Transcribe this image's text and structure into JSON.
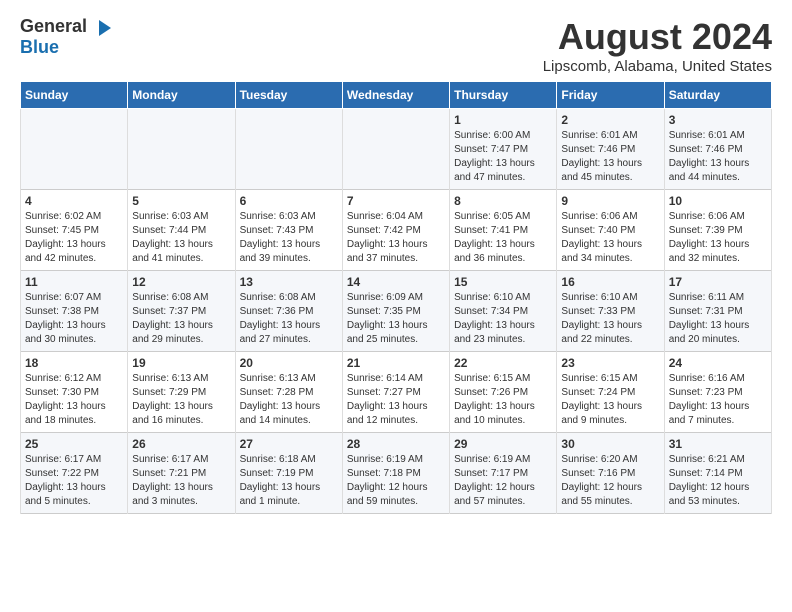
{
  "logo": {
    "general": "General",
    "blue": "Blue"
  },
  "title": {
    "month": "August 2024",
    "location": "Lipscomb, Alabama, United States"
  },
  "headers": [
    "Sunday",
    "Monday",
    "Tuesday",
    "Wednesday",
    "Thursday",
    "Friday",
    "Saturday"
  ],
  "weeks": [
    [
      {
        "day": "",
        "info": ""
      },
      {
        "day": "",
        "info": ""
      },
      {
        "day": "",
        "info": ""
      },
      {
        "day": "",
        "info": ""
      },
      {
        "day": "1",
        "info": "Sunrise: 6:00 AM\nSunset: 7:47 PM\nDaylight: 13 hours\nand 47 minutes."
      },
      {
        "day": "2",
        "info": "Sunrise: 6:01 AM\nSunset: 7:46 PM\nDaylight: 13 hours\nand 45 minutes."
      },
      {
        "day": "3",
        "info": "Sunrise: 6:01 AM\nSunset: 7:46 PM\nDaylight: 13 hours\nand 44 minutes."
      }
    ],
    [
      {
        "day": "4",
        "info": "Sunrise: 6:02 AM\nSunset: 7:45 PM\nDaylight: 13 hours\nand 42 minutes."
      },
      {
        "day": "5",
        "info": "Sunrise: 6:03 AM\nSunset: 7:44 PM\nDaylight: 13 hours\nand 41 minutes."
      },
      {
        "day": "6",
        "info": "Sunrise: 6:03 AM\nSunset: 7:43 PM\nDaylight: 13 hours\nand 39 minutes."
      },
      {
        "day": "7",
        "info": "Sunrise: 6:04 AM\nSunset: 7:42 PM\nDaylight: 13 hours\nand 37 minutes."
      },
      {
        "day": "8",
        "info": "Sunrise: 6:05 AM\nSunset: 7:41 PM\nDaylight: 13 hours\nand 36 minutes."
      },
      {
        "day": "9",
        "info": "Sunrise: 6:06 AM\nSunset: 7:40 PM\nDaylight: 13 hours\nand 34 minutes."
      },
      {
        "day": "10",
        "info": "Sunrise: 6:06 AM\nSunset: 7:39 PM\nDaylight: 13 hours\nand 32 minutes."
      }
    ],
    [
      {
        "day": "11",
        "info": "Sunrise: 6:07 AM\nSunset: 7:38 PM\nDaylight: 13 hours\nand 30 minutes."
      },
      {
        "day": "12",
        "info": "Sunrise: 6:08 AM\nSunset: 7:37 PM\nDaylight: 13 hours\nand 29 minutes."
      },
      {
        "day": "13",
        "info": "Sunrise: 6:08 AM\nSunset: 7:36 PM\nDaylight: 13 hours\nand 27 minutes."
      },
      {
        "day": "14",
        "info": "Sunrise: 6:09 AM\nSunset: 7:35 PM\nDaylight: 13 hours\nand 25 minutes."
      },
      {
        "day": "15",
        "info": "Sunrise: 6:10 AM\nSunset: 7:34 PM\nDaylight: 13 hours\nand 23 minutes."
      },
      {
        "day": "16",
        "info": "Sunrise: 6:10 AM\nSunset: 7:33 PM\nDaylight: 13 hours\nand 22 minutes."
      },
      {
        "day": "17",
        "info": "Sunrise: 6:11 AM\nSunset: 7:31 PM\nDaylight: 13 hours\nand 20 minutes."
      }
    ],
    [
      {
        "day": "18",
        "info": "Sunrise: 6:12 AM\nSunset: 7:30 PM\nDaylight: 13 hours\nand 18 minutes."
      },
      {
        "day": "19",
        "info": "Sunrise: 6:13 AM\nSunset: 7:29 PM\nDaylight: 13 hours\nand 16 minutes."
      },
      {
        "day": "20",
        "info": "Sunrise: 6:13 AM\nSunset: 7:28 PM\nDaylight: 13 hours\nand 14 minutes."
      },
      {
        "day": "21",
        "info": "Sunrise: 6:14 AM\nSunset: 7:27 PM\nDaylight: 13 hours\nand 12 minutes."
      },
      {
        "day": "22",
        "info": "Sunrise: 6:15 AM\nSunset: 7:26 PM\nDaylight: 13 hours\nand 10 minutes."
      },
      {
        "day": "23",
        "info": "Sunrise: 6:15 AM\nSunset: 7:24 PM\nDaylight: 13 hours\nand 9 minutes."
      },
      {
        "day": "24",
        "info": "Sunrise: 6:16 AM\nSunset: 7:23 PM\nDaylight: 13 hours\nand 7 minutes."
      }
    ],
    [
      {
        "day": "25",
        "info": "Sunrise: 6:17 AM\nSunset: 7:22 PM\nDaylight: 13 hours\nand 5 minutes."
      },
      {
        "day": "26",
        "info": "Sunrise: 6:17 AM\nSunset: 7:21 PM\nDaylight: 13 hours\nand 3 minutes."
      },
      {
        "day": "27",
        "info": "Sunrise: 6:18 AM\nSunset: 7:19 PM\nDaylight: 13 hours\nand 1 minute."
      },
      {
        "day": "28",
        "info": "Sunrise: 6:19 AM\nSunset: 7:18 PM\nDaylight: 12 hours\nand 59 minutes."
      },
      {
        "day": "29",
        "info": "Sunrise: 6:19 AM\nSunset: 7:17 PM\nDaylight: 12 hours\nand 57 minutes."
      },
      {
        "day": "30",
        "info": "Sunrise: 6:20 AM\nSunset: 7:16 PM\nDaylight: 12 hours\nand 55 minutes."
      },
      {
        "day": "31",
        "info": "Sunrise: 6:21 AM\nSunset: 7:14 PM\nDaylight: 12 hours\nand 53 minutes."
      }
    ]
  ]
}
